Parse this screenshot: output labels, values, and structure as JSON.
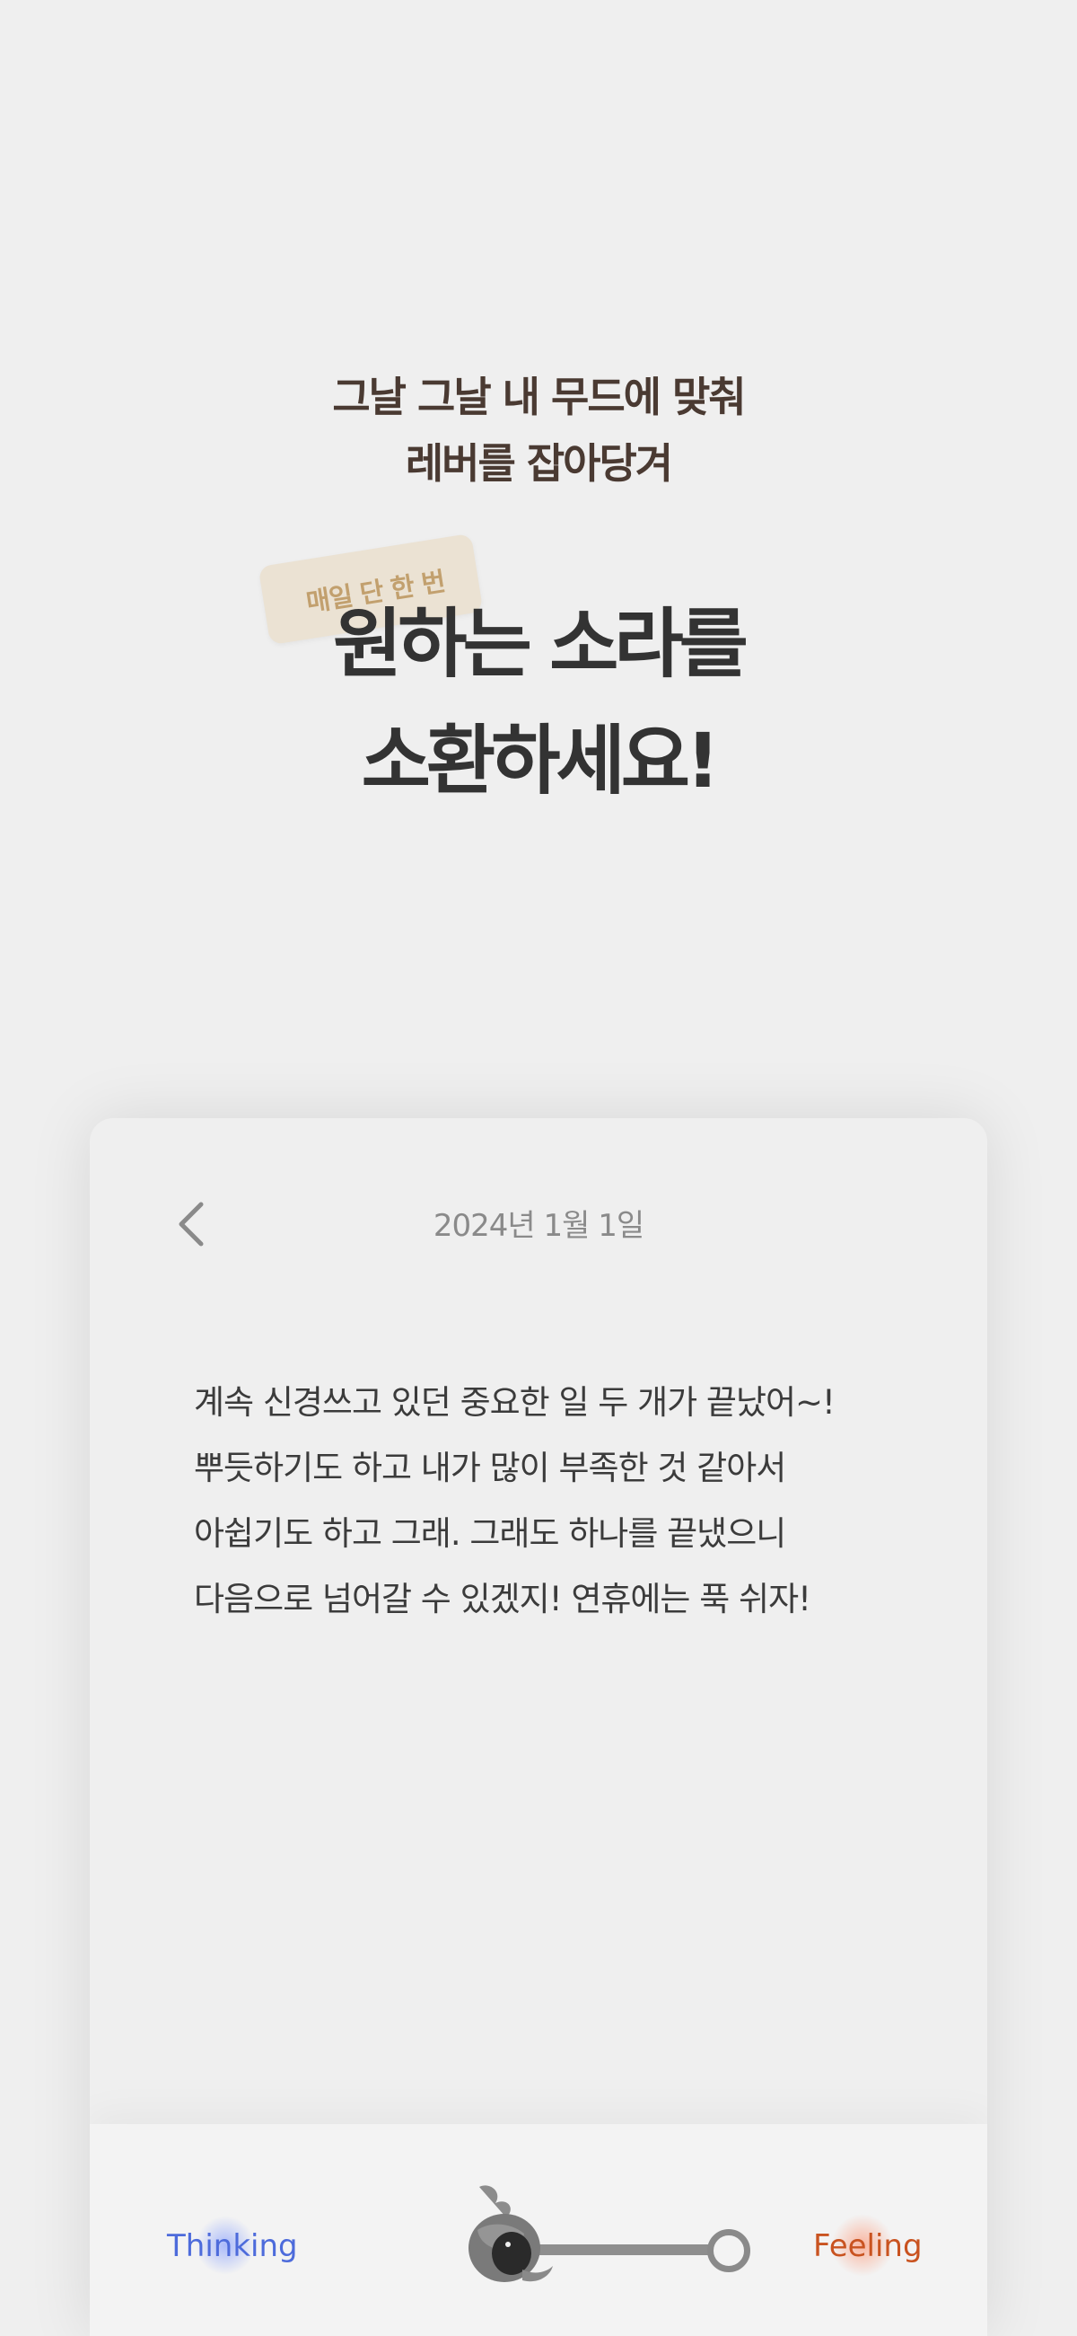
{
  "intro": {
    "subtitle_line1": "그날 그날 내 무드에 맞춰",
    "subtitle_line2": "레버를 잡아당겨",
    "badge": "매일 단 한 번",
    "headline_line1": "원하는 소라를",
    "headline_line2": "소환하세요!"
  },
  "diary": {
    "date": "2024년 1월 1일",
    "content": "계속 신경쓰고 있던 중요한 일 두 개가 끝났어~! 뿌듯하기도 하고 내가 많이 부족한 것 같아서 아쉽기도 하고 그래. 그래도 하나를 끝냈으니 다음으로 넘어갈 수 있겠지! 연휴에는 푹 쉬자!"
  },
  "mood_lever": {
    "left_label": "Thinking",
    "right_label": "Feeling",
    "left_color": "#4d6bdb",
    "right_color": "#c95320"
  },
  "icons": {
    "back": "chevron-left-icon",
    "lever_handle": "conch-shell-icon"
  }
}
